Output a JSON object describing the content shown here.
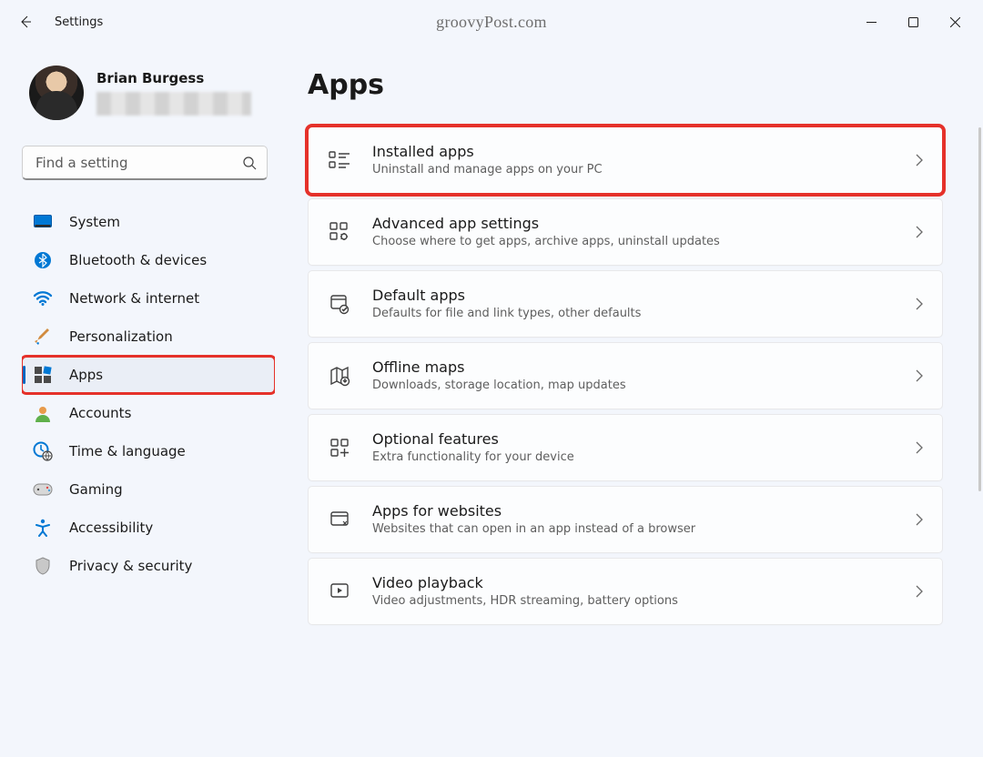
{
  "window": {
    "title": "Settings",
    "watermark": "groovyPost.com"
  },
  "user": {
    "name": "Brian Burgess"
  },
  "search": {
    "placeholder": "Find a setting"
  },
  "sidebar": {
    "items": [
      {
        "label": "System"
      },
      {
        "label": "Bluetooth & devices"
      },
      {
        "label": "Network & internet"
      },
      {
        "label": "Personalization"
      },
      {
        "label": "Apps"
      },
      {
        "label": "Accounts"
      },
      {
        "label": "Time & language"
      },
      {
        "label": "Gaming"
      },
      {
        "label": "Accessibility"
      },
      {
        "label": "Privacy & security"
      }
    ]
  },
  "main": {
    "heading": "Apps",
    "cards": [
      {
        "title": "Installed apps",
        "subtitle": "Uninstall and manage apps on your PC"
      },
      {
        "title": "Advanced app settings",
        "subtitle": "Choose where to get apps, archive apps, uninstall updates"
      },
      {
        "title": "Default apps",
        "subtitle": "Defaults for file and link types, other defaults"
      },
      {
        "title": "Offline maps",
        "subtitle": "Downloads, storage location, map updates"
      },
      {
        "title": "Optional features",
        "subtitle": "Extra functionality for your device"
      },
      {
        "title": "Apps for websites",
        "subtitle": "Websites that can open in an app instead of a browser"
      },
      {
        "title": "Video playback",
        "subtitle": "Video adjustments, HDR streaming, battery options"
      }
    ]
  }
}
